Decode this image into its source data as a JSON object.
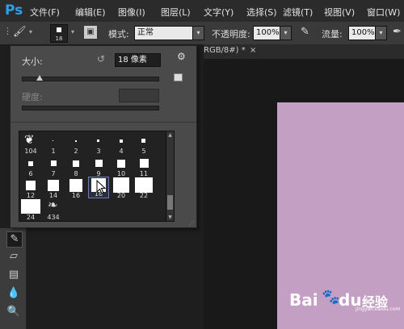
{
  "app": {
    "logo": "Ps"
  },
  "menu": [
    "文件(F)",
    "编辑(E)",
    "图像(I)",
    "图层(L)",
    "文字(Y)",
    "选择(S)",
    "滤镜(T)",
    "视图(V)",
    "窗口(W)"
  ],
  "options": {
    "brush_size": "18",
    "mode_label": "模式:",
    "mode_value": "正常",
    "opacity_label": "不透明度:",
    "opacity_value": "100%",
    "flow_label": "流量:",
    "flow_value": "100%"
  },
  "document": {
    "tab_title": "RGB/8#) *",
    "close_glyph": "×",
    "canvas_color": "#c39fc3"
  },
  "brush_panel": {
    "size_label": "大小:",
    "size_value": "18 像素",
    "size_level": 0.05,
    "hardness_label": "硬度:",
    "presets": [
      "104",
      "1",
      "2",
      "3",
      "4",
      "5",
      "6",
      "7",
      "8",
      "9",
      "10",
      "11",
      "12",
      "14",
      "16",
      "18",
      "20",
      "22",
      "24",
      "434"
    ],
    "selected": "18"
  },
  "watermark": {
    "brand": "Bai",
    "brand_tail": "du",
    "suffix": "经验",
    "url": "jingyan.baidu.com"
  }
}
